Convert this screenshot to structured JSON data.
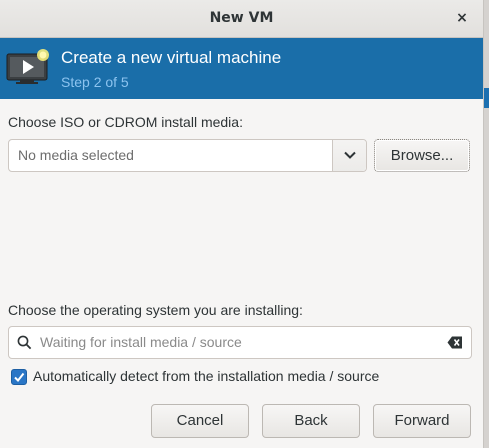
{
  "window": {
    "title": "New VM",
    "close_glyph": "×"
  },
  "banner": {
    "icon": "vm-screen-icon",
    "heading": "Create a new virtual machine",
    "step": "Step 2 of 5",
    "color": "#1a6ea9"
  },
  "media": {
    "label": "Choose ISO or CDROM install media:",
    "selected": "No media selected",
    "browse_label": "Browse..."
  },
  "os": {
    "label": "Choose the operating system you are installing:",
    "search_placeholder": "Waiting for install media / source",
    "auto_detect_label": "Automatically detect from the installation media / source",
    "auto_detect_checked": true
  },
  "buttons": {
    "cancel": "Cancel",
    "back": "Back",
    "forward": "Forward"
  }
}
